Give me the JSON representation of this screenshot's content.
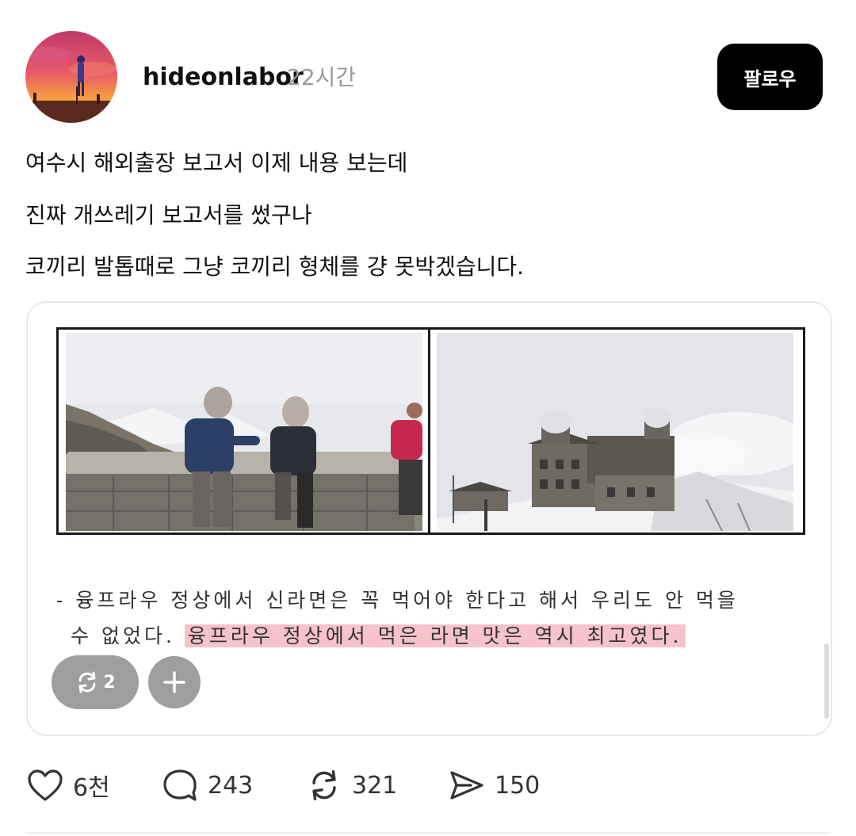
{
  "post": {
    "username": "hideonlabor",
    "time": "22시간",
    "follow_label": "팔로우",
    "lines": [
      "여수시 해외출장 보고서 이제 내용 보는데",
      "진짜 개쓰레기 보고서를 썼구나",
      "코끼리 발톱때로 그냥 코끼리 형체를 걍 못박겠습니다."
    ]
  },
  "attachment": {
    "report_line1": "- 융프라우 정상에서 신라면은 꼭 먹어야 한다고 해서 우리도 안 먹을",
    "report_line2_plain": "수 없었다.",
    "report_line2_highlight": "융프라우 정상에서 먹은 라면 맛은 역시 최고였다.",
    "highlight_color": "#f6c2cb",
    "repost_count": "2"
  },
  "actions": {
    "likes": "6천",
    "comments": "243",
    "reposts": "321",
    "shares": "150"
  }
}
